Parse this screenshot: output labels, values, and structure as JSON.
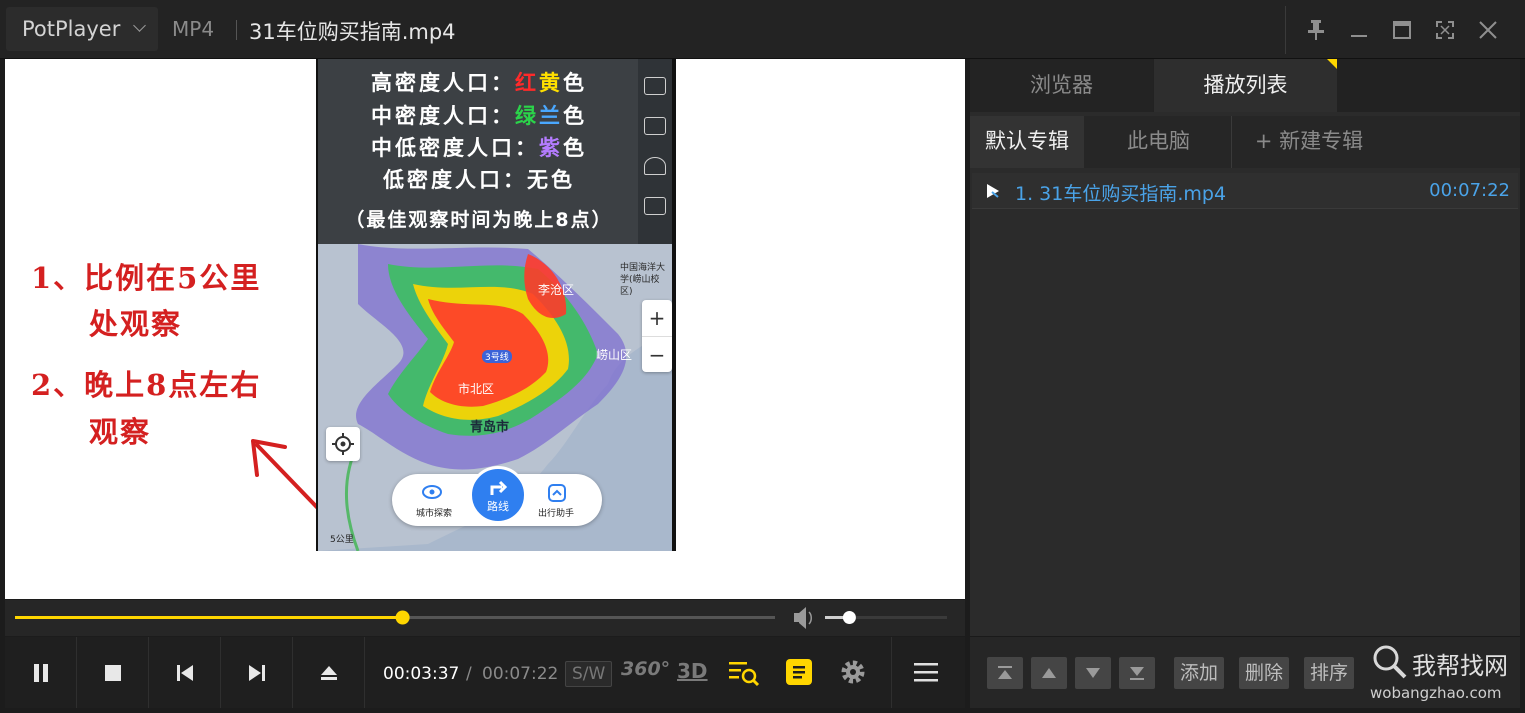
{
  "titlebar": {
    "app_name": "PotPlayer",
    "format": "MP4",
    "file_title": "31车位购买指南.mp4"
  },
  "video": {
    "note1_line1": "1、比例在5公里",
    "note1_line2": "处观察",
    "note2_line1": "2、晚上8点左右",
    "note2_line2": "观察",
    "legend": [
      {
        "prefix": "高密度人口：",
        "colored": [
          {
            "t": "红",
            "c": "#ff2a2a"
          },
          {
            "t": "黄",
            "c": "#ffe000"
          }
        ],
        "suffix": "色"
      },
      {
        "prefix": "中密度人口：",
        "colored": [
          {
            "t": "绿",
            "c": "#2bd44a"
          },
          {
            "t": "兰",
            "c": "#4aa8ff"
          }
        ],
        "suffix": "色"
      },
      {
        "prefix": "中低密度人口：",
        "colored": [
          {
            "t": "紫",
            "c": "#b47cff"
          }
        ],
        "suffix": "色"
      },
      {
        "prefix": "低密度人口：无色",
        "colored": [],
        "suffix": ""
      }
    ],
    "legend_note": "（最佳观察时间为晚上8点）",
    "map": {
      "labels": {
        "licang": "李沧区",
        "shibei": "市北区",
        "qingdao": "青岛市",
        "laoshan": "崂山区",
        "line3": "3号线",
        "ocean": "中国海洋大学(崂山校区)"
      },
      "zoom_in": "+",
      "zoom_out": "−",
      "pill_left": "城市探索",
      "pill_route": "路线",
      "pill_right": "出行助手",
      "scale": "5公里"
    }
  },
  "playback": {
    "current_time": "00:03:37",
    "separator": "/",
    "total_time": "00:07:22",
    "sw_label": "S/W",
    "label_360": "360°",
    "label_3d": "3D",
    "progress": 0.51,
    "volume": 0.2
  },
  "panel": {
    "tab_browser": "浏览器",
    "tab_playlist": "播放列表",
    "sub_default": "默认专辑",
    "sub_pc": "此电脑",
    "sub_new": "+ 新建专辑",
    "playlist": [
      {
        "name": "1. 31车位购买指南.mp4",
        "duration": "00:07:22"
      }
    ],
    "btn_add": "添加",
    "btn_delete": "删除",
    "btn_sort": "排序"
  },
  "watermark": {
    "line1": "我帮找网",
    "line2": "wobangzhao.com"
  },
  "colors": {
    "accent": "#ffd600",
    "link": "#4aa3e8"
  }
}
